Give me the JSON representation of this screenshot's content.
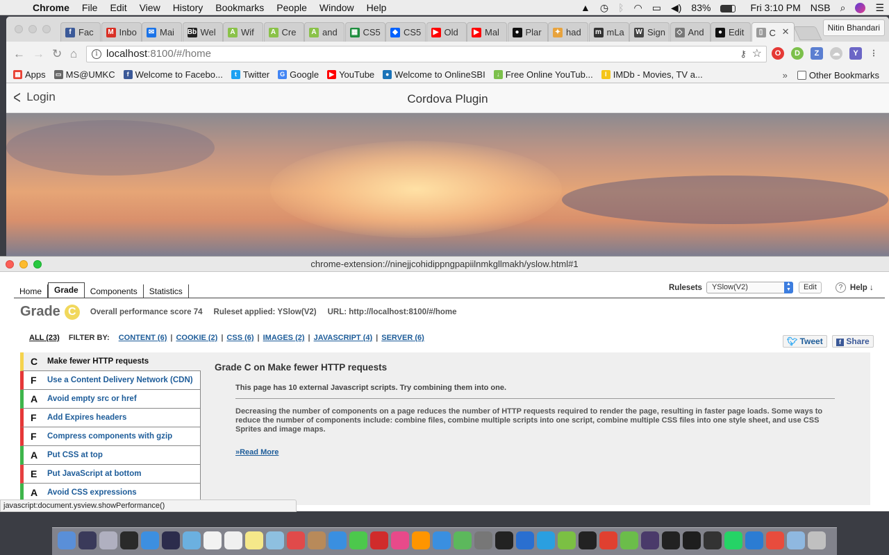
{
  "menubar": {
    "app": "Chrome",
    "items": [
      "File",
      "Edit",
      "View",
      "History",
      "Bookmarks",
      "People",
      "Window",
      "Help"
    ],
    "battery": "83%",
    "clock": "Fri 3:10 PM",
    "user": "NSB"
  },
  "browser": {
    "tabs": [
      {
        "label": "Fac",
        "color": "#3b5998",
        "glyph": "f"
      },
      {
        "label": "Inbo",
        "color": "#d93025",
        "glyph": "M"
      },
      {
        "label": "Mai",
        "color": "#1a73e8",
        "glyph": "✉"
      },
      {
        "label": "Wel",
        "color": "#222222",
        "glyph": "Bb"
      },
      {
        "label": "Wif",
        "color": "#8ac249",
        "glyph": "A"
      },
      {
        "label": "Cre",
        "color": "#8ac249",
        "glyph": "A"
      },
      {
        "label": "and",
        "color": "#8ac249",
        "glyph": "A"
      },
      {
        "label": "CS5",
        "color": "#1e8e3e",
        "glyph": "▦"
      },
      {
        "label": "CS5",
        "color": "#0061fe",
        "glyph": "◆"
      },
      {
        "label": "Old",
        "color": "#ff0000",
        "glyph": "▶"
      },
      {
        "label": "Mal",
        "color": "#ff0000",
        "glyph": "▶"
      },
      {
        "label": "Plar",
        "color": "#111111",
        "glyph": "●"
      },
      {
        "label": "had",
        "color": "#e8a33d",
        "glyph": "✦"
      },
      {
        "label": "mLa",
        "color": "#333333",
        "glyph": "m"
      },
      {
        "label": "Sign",
        "color": "#444444",
        "glyph": "W"
      },
      {
        "label": "And",
        "color": "#777777",
        "glyph": "◇"
      },
      {
        "label": "Edit",
        "color": "#111111",
        "glyph": "●"
      },
      {
        "label": "C",
        "color": "#999999",
        "glyph": "▯"
      }
    ],
    "profile": "Nitin Bhandari",
    "url_host": "localhost",
    "url_path": ":8100/#/home",
    "bookmarks": [
      {
        "label": "Apps",
        "color": "#e94235",
        "glyph": "▦"
      },
      {
        "label": "MS@UMKC",
        "color": "#666666",
        "glyph": "▭"
      },
      {
        "label": "Welcome to Facebo...",
        "color": "#3b5998",
        "glyph": "f"
      },
      {
        "label": "Twitter",
        "color": "#1da1f2",
        "glyph": "t"
      },
      {
        "label": "Google",
        "color": "#4285f4",
        "glyph": "G"
      },
      {
        "label": "YouTube",
        "color": "#ff0000",
        "glyph": "▶"
      },
      {
        "label": "Welcome to OnlineSBI",
        "color": "#1a73b8",
        "glyph": "●"
      },
      {
        "label": "Free Online YouTub...",
        "color": "#7cc04b",
        "glyph": "↓"
      },
      {
        "label": "IMDb - Movies, TV a...",
        "color": "#f5c518",
        "glyph": "I"
      }
    ],
    "overflow": "»",
    "other_bookmarks": "Other Bookmarks"
  },
  "app": {
    "back_label": "Login",
    "title": "Cordova Plugin"
  },
  "yslow": {
    "window_title": "chrome-extension://ninejjcohidippngpapiilnmkgllmakh/yslow.html#1",
    "tabs": [
      "Home",
      "Grade",
      "Components",
      "Statistics"
    ],
    "active_tab": "Grade",
    "rulesets_label": "Rulesets",
    "ruleset_value": "YSlow(V2)",
    "edit_label": "Edit",
    "help_label": "Help ↓",
    "grade_label": "Grade",
    "grade": "C",
    "score_text": "Overall performance score 74",
    "ruleset_text": "Ruleset applied: YSlow(V2)",
    "url_text": "URL: http://localhost:8100/#/home",
    "filters": {
      "all": "ALL (23)",
      "filter_by": "FILTER BY:",
      "items": [
        "CONTENT (6)",
        "COOKIE (2)",
        "CSS (6)",
        "IMAGES (2)",
        "JAVASCRIPT (4)",
        "SERVER (6)"
      ]
    },
    "tweet_label": "Tweet",
    "share_label": "Share",
    "rules": [
      {
        "grade": "C",
        "label": "Make fewer HTTP requests"
      },
      {
        "grade": "F",
        "label": "Use a Content Delivery Network (CDN)"
      },
      {
        "grade": "A",
        "label": "Avoid empty src or href"
      },
      {
        "grade": "F",
        "label": "Add Expires headers"
      },
      {
        "grade": "F",
        "label": "Compress components with gzip"
      },
      {
        "grade": "A",
        "label": "Put CSS at top"
      },
      {
        "grade": "E",
        "label": "Put JavaScript at bottom"
      },
      {
        "grade": "A",
        "label": "Avoid CSS expressions"
      }
    ],
    "detail": {
      "heading": "Grade C on Make fewer HTTP requests",
      "message": "This page has 10 external Javascript scripts. Try combining them into one.",
      "description": "Decreasing the number of components on a page reduces the number of HTTP requests required to render the page, resulting in faster page loads. Some ways to reduce the number of components include: combine files, combine multiple scripts into one script, combine multiple CSS files into one style sheet, and use CSS Sprites and image maps.",
      "read_more": "»Read More"
    }
  },
  "statusbar": "javascript:document.ysview.showPerformance()",
  "dock_colors": [
    "#5a8fd8",
    "#3a3a5a",
    "#b0b0c0",
    "#2a2a2a",
    "#3d8fe0",
    "#2c2c4c",
    "#6bb0e0",
    "#f2f2f2",
    "#f0f0f0",
    "#f5e88a",
    "#8ec0e0",
    "#e04a4a",
    "#b88a5a",
    "#3a8fe0",
    "#4cc84c",
    "#d02b2b",
    "#e84a8a",
    "#ff9500",
    "#3a8fe0",
    "#5cb85c",
    "#777777",
    "#222222",
    "#2a6fd0",
    "#2a9fe0",
    "#7bc043",
    "#222222",
    "#e04030",
    "#6bbd4a",
    "#4a3a6a",
    "#222222",
    "#1e1e1e",
    "#333333",
    "#25d366",
    "#2b7cd3",
    "#e84c3d",
    "#8fb8e0",
    "#c0c0c0"
  ]
}
